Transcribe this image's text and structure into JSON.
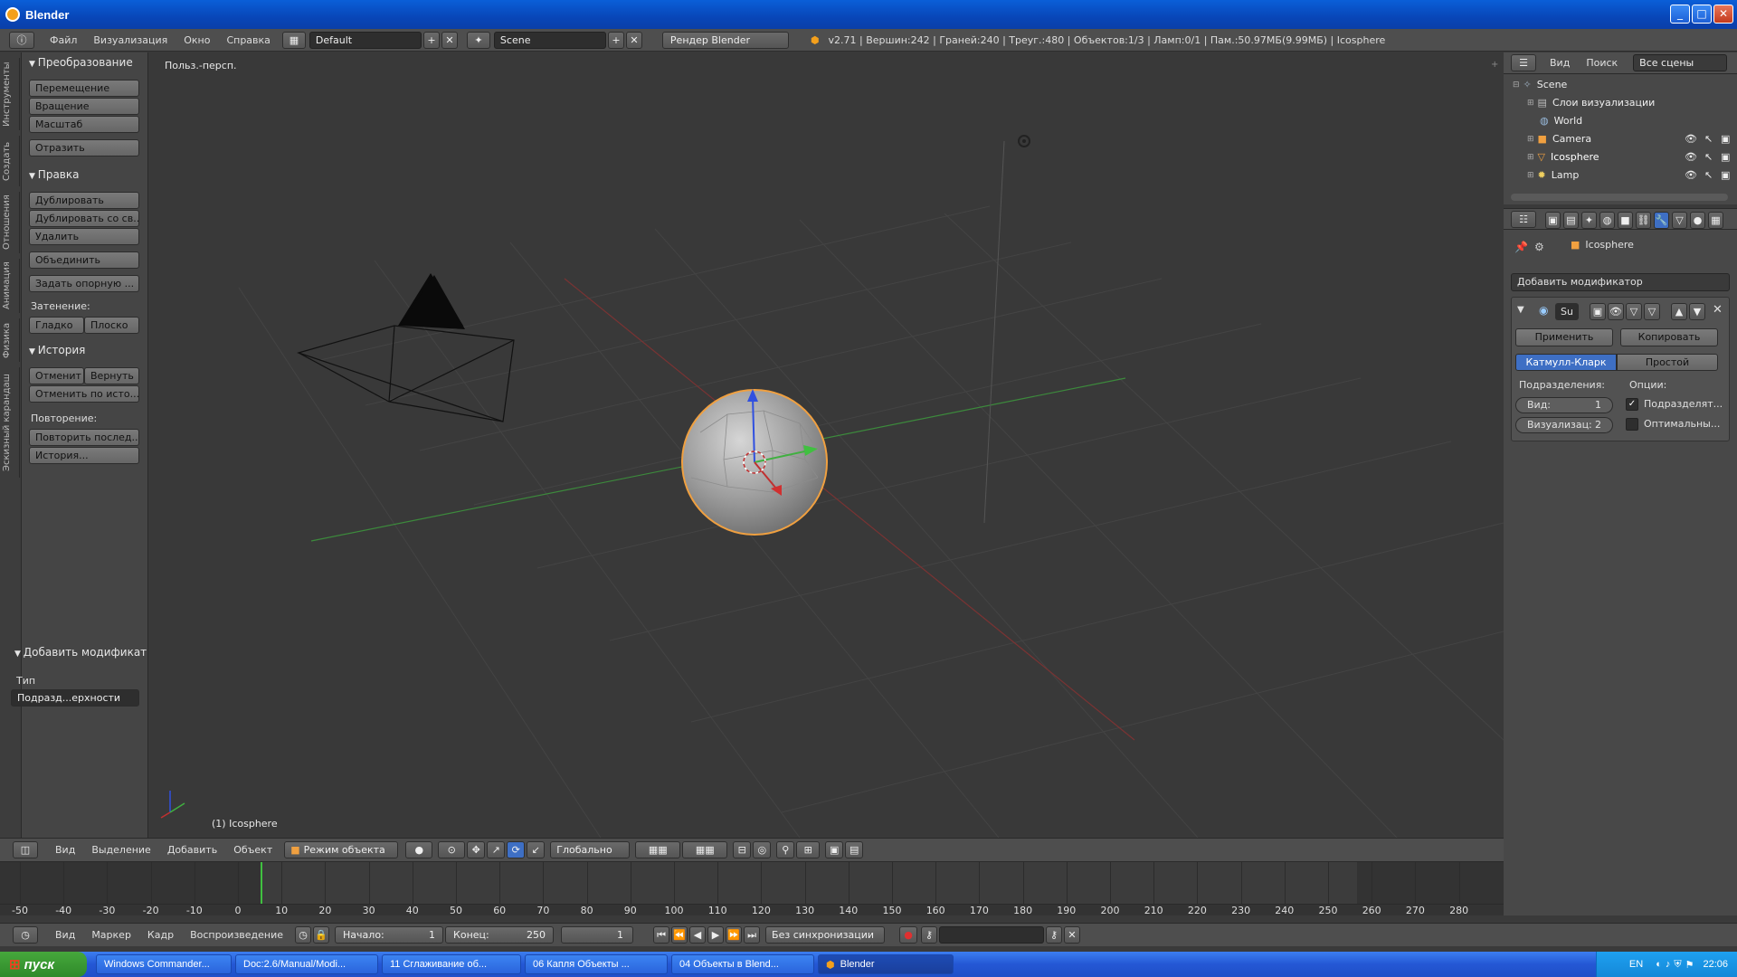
{
  "window": {
    "title": "Blender"
  },
  "info_header": {
    "menus": [
      "Файл",
      "Визуализация",
      "Окно",
      "Справка"
    ],
    "layout": "Default",
    "scene": "Scene",
    "engine": "Рендер Blender",
    "stats": "v2.71 | Вершин:242 | Граней:240 | Треуг.:480 | Объектов:1/3 | Ламп:0/1 | Пам.:50.97МБ(9.99МБ) | Icosphere"
  },
  "tool_tabs": [
    "Инструменты",
    "Создать",
    "Отношения",
    "Анимация",
    "Физика",
    "Эскизный карандаш"
  ],
  "toolshelf": {
    "transform": {
      "title": "Преобразование",
      "buttons": [
        "Перемещение",
        "Вращение",
        "Масштаб",
        "Отразить"
      ]
    },
    "edit": {
      "title": "Правка",
      "buttons": [
        "Дублировать",
        "Дублировать со св...",
        "Удалить",
        "Объединить",
        "Задать опорную ..."
      ],
      "shading_label": "Затенение:",
      "smooth": "Гладко",
      "flat": "Плоско"
    },
    "history": {
      "title": "История",
      "undo": "Отменит",
      "redo": "Вернуть",
      "undo_history": "Отменить по исто...",
      "repeat_label": "Повторение:",
      "repeat_last": "Повторить послед...",
      "history": "История..."
    },
    "operator": {
      "title": "Добавить модификат",
      "type_label": "Тип",
      "type_value": "Подразд...ерхности"
    }
  },
  "viewport": {
    "view_name": "Польз.-персп.",
    "object_label": "(1) Icosphere"
  },
  "outliner": {
    "menus": [
      "Вид",
      "Поиск"
    ],
    "filter": "Все сцены",
    "items": [
      "Scene",
      "Слои визуализации",
      "World",
      "Camera",
      "Icosphere",
      "Lamp"
    ]
  },
  "properties": {
    "breadcrumb": "Icosphere",
    "add_modifier": "Добавить модификатор",
    "modifier_name": "Su",
    "apply": "Применить",
    "copy": "Копировать",
    "catmull": "Катмулл-Кларк",
    "simple": "Простой",
    "subdiv_label": "Подразделения:",
    "options_label": "Опции:",
    "view_field": "Вид:",
    "view_value": "1",
    "render_field": "Визуализац:",
    "render_value": "2",
    "opt1": "Подразделят...",
    "opt2": "Оптимальны..."
  },
  "view3d_header": {
    "menus": [
      "Вид",
      "Выделение",
      "Добавить",
      "Объект"
    ],
    "mode": "Режим объекта",
    "orientation": "Глобально"
  },
  "timeline": {
    "ticks": [
      "-50",
      "-40",
      "-30",
      "-20",
      "-10",
      "0",
      "10",
      "20",
      "30",
      "40",
      "50",
      "60",
      "70",
      "80",
      "90",
      "100",
      "110",
      "120",
      "130",
      "140",
      "150",
      "160",
      "170",
      "180",
      "190",
      "200",
      "210",
      "220",
      "230",
      "240",
      "250",
      "260",
      "270",
      "280"
    ],
    "menus": [
      "Вид",
      "Маркер",
      "Кадр",
      "Воспроизведение"
    ],
    "start": "Начало:",
    "start_value": "1",
    "end": "Конец:",
    "end_value": "250",
    "current": "1",
    "sync": "Без синхронизации"
  },
  "taskbar": {
    "start": "пуск",
    "items": [
      "Windows Commander...",
      "Doc:2.6/Manual/Modi...",
      "11 Сглаживание об...",
      "06 Капля Объекты ...",
      "04 Объекты в Blend...",
      "Blender"
    ],
    "lang": "EN",
    "clock": "22:06"
  },
  "colors": {
    "selection": "#f0a040",
    "x_axis": "#c03030",
    "y_axis": "#40b040",
    "z_axis": "#3050e0",
    "active_blue": "#3e6fc4"
  }
}
